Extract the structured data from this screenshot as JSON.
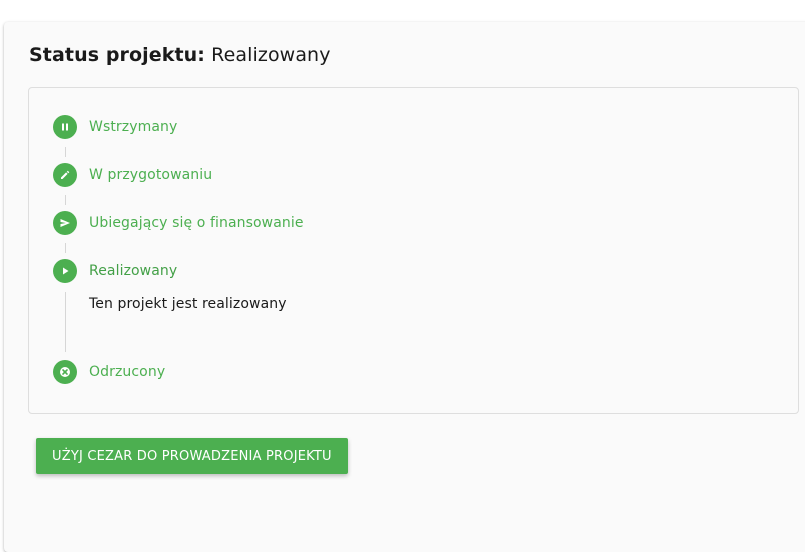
{
  "colors": {
    "accent": "#4caf50",
    "card_background": "#fafafa",
    "border": "#dedede"
  },
  "header": {
    "title_label": "Status projektu:",
    "title_value": "Realizowany"
  },
  "stepper": {
    "steps": [
      {
        "label": "Wstrzymany",
        "icon": "pause-icon",
        "active": false
      },
      {
        "label": "W przygotowaniu",
        "icon": "pencil-icon",
        "active": false
      },
      {
        "label": "Ubiegający się o finansowanie",
        "icon": "send-icon",
        "active": false
      },
      {
        "label": "Realizowany",
        "icon": "play-icon",
        "active": true,
        "description": "Ten projekt jest realizowany"
      },
      {
        "label": "Odrzucony",
        "icon": "close-circle-icon",
        "active": false
      }
    ]
  },
  "actions": {
    "primary_label": "UŻYJ CEZAR DO PROWADZENIA PROJEKTU"
  }
}
